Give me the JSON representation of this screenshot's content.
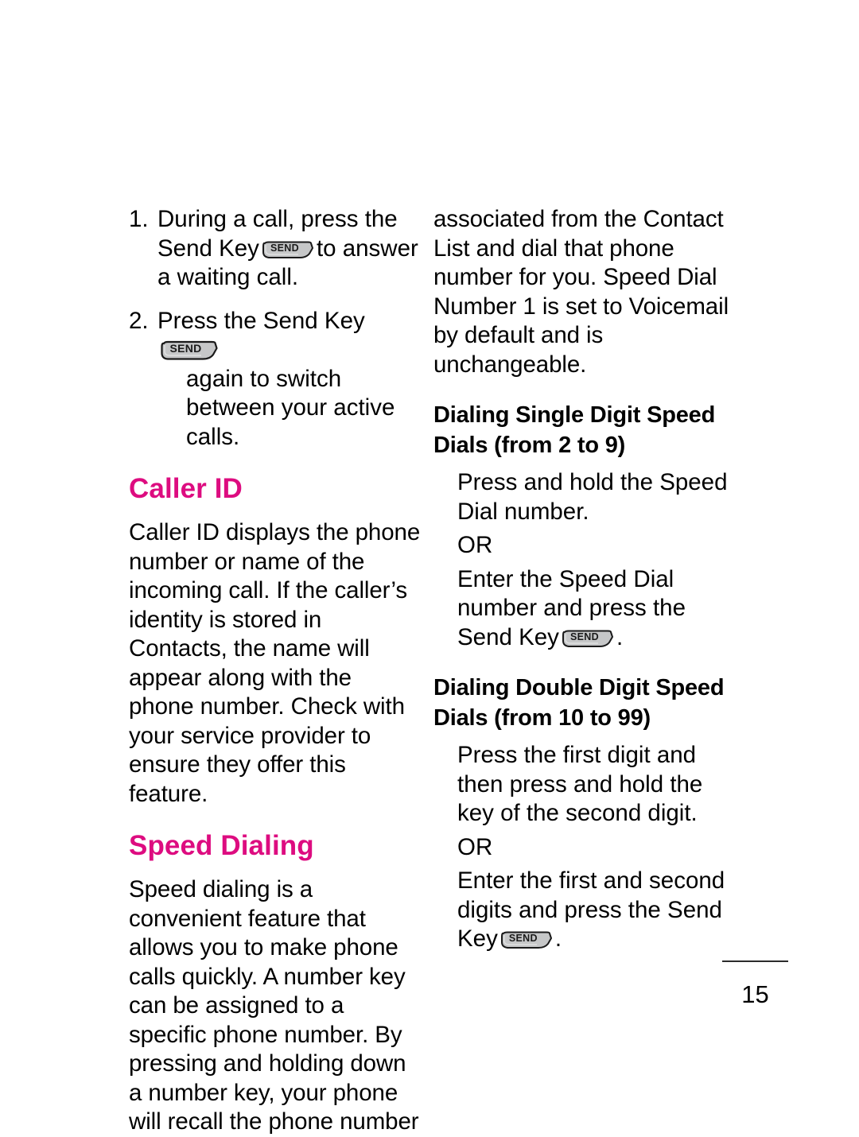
{
  "document": {
    "page_number": "15"
  },
  "left_column": {
    "steps": [
      {
        "marker": "1.",
        "text_before_icon": "During a call, press the Send Key",
        "icon": "send-key-icon",
        "text_after_icon": "to answer a waiting call."
      },
      {
        "marker": "2.",
        "text_before_icon": "Press the Send Key",
        "icon": "send-key-icon",
        "text_after_icon": "again to switch between your active calls."
      }
    ],
    "sections": [
      {
        "heading": "Caller ID",
        "body": "Caller ID displays the phone number or name of the incoming call. If the caller’s identity is stored in Contacts, the name will appear along with the phone number. Check with your service provider to ensure they offer this feature."
      },
      {
        "heading": "Speed Dialing",
        "body": "Speed dialing is a convenient feature that allows you to make phone calls quickly. A number key can be assigned to a specific phone number. By pressing and holding down a number key, your phone will recall the phone number"
      }
    ]
  },
  "right_column": {
    "continuation": "associated from the Contact List and dial that phone number for you. Speed Dial Number 1 is set to Voicemail by default and is unchangeable.",
    "single_digit": {
      "heading": "Dialing Single Digit Speed Dials (from 2 to 9)",
      "step_one": "Press and hold the Speed Dial number.",
      "or_label": "OR",
      "step_two_before_icon": "Enter the Speed Dial number and press the Send Key",
      "icon": "send-key-icon",
      "step_two_after_icon": "."
    },
    "double_digit": {
      "heading": "Dialing Double Digit Speed Dials (from 10 to 99)",
      "step_one": "Press the first digit and then press and hold the key of the second digit.",
      "or_label": "OR",
      "step_two_before_icon": "Enter the first and second digits and press the Send Key",
      "icon": "send-key-icon",
      "step_two_after_icon": "."
    }
  },
  "icons": {
    "send_key_label": "SEND"
  },
  "colors": {
    "heading_pink": "#DD0C80",
    "body_text": "#000000",
    "send_key_fill": "#C6C7C8",
    "send_key_stroke": "#1a1a1a"
  }
}
